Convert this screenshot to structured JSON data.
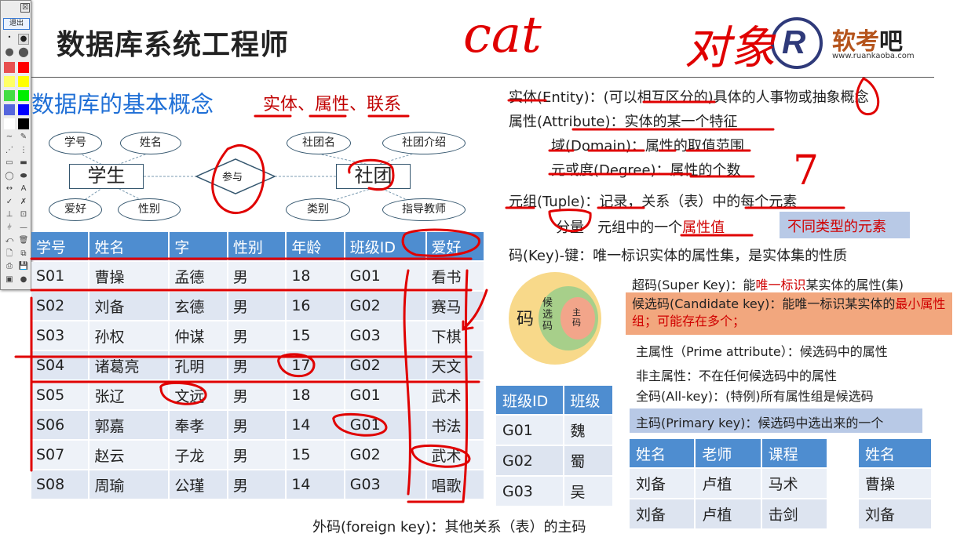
{
  "toolbar": {
    "exit_label": "退出",
    "close": "☒",
    "colors": [
      "#e85050",
      "#ff0000",
      "#ffff66",
      "#ffff00",
      "#44dd44",
      "#00ee00",
      "#5566dd",
      "#0000ff",
      "#ffffff",
      "#000000"
    ],
    "tools": [
      "~",
      "✎",
      "⋰",
      "⋮",
      "▭",
      "▬",
      "◯",
      "⬬",
      "↔",
      "A",
      "✓",
      "✗",
      "⊥",
      "⊡",
      "⫩",
      "—",
      "⤺",
      "🗑",
      "🗋",
      "⧉",
      "⎙",
      "💾",
      "▣",
      "●"
    ]
  },
  "slide": {
    "title": "数据库系统工程师",
    "logo": {
      "brand_a": "软考",
      "brand_b": "吧",
      "url": "www.ruankaoba.com"
    },
    "subtitle": "数据库的基本概念",
    "hint": "实体、属性、联系",
    "er": {
      "entity_left": "学生",
      "entity_right": "社团",
      "relation": "参与",
      "attrs_left": [
        "学号",
        "姓名",
        "爱好",
        "性别"
      ],
      "attrs_right": [
        "社团名",
        "社团介绍",
        "类别",
        "指导教师"
      ]
    },
    "main_table": {
      "headers": [
        "学号",
        "姓名",
        "字",
        "性别",
        "年龄",
        "班级ID",
        "爱好"
      ],
      "rows": [
        [
          "S01",
          "曹操",
          "孟德",
          "男",
          "18",
          "G01",
          "看书"
        ],
        [
          "S02",
          "刘备",
          "玄德",
          "男",
          "16",
          "G02",
          "赛马"
        ],
        [
          "S03",
          "孙权",
          "仲谋",
          "男",
          "15",
          "G03",
          "下棋"
        ],
        [
          "S04",
          "诸葛亮",
          "孔明",
          "男",
          "17",
          "G02",
          "天文"
        ],
        [
          "S05",
          "张辽",
          "文远",
          "男",
          "18",
          "G01",
          "武术"
        ],
        [
          "S06",
          "郭嘉",
          "奉孝",
          "男",
          "14",
          "G01",
          "书法"
        ],
        [
          "S07",
          "赵云",
          "子龙",
          "男",
          "15",
          "G02",
          "武术"
        ],
        [
          "S08",
          "周瑜",
          "公瑾",
          "男",
          "14",
          "G03",
          "唱歌"
        ]
      ]
    },
    "class_table": {
      "headers": [
        "班级ID",
        "班级"
      ],
      "rows": [
        [
          "G01",
          "魏"
        ],
        [
          "G02",
          "蜀"
        ],
        [
          "G03",
          "吴"
        ]
      ]
    },
    "course_table": {
      "headers": [
        "姓名",
        "老师",
        "课程"
      ],
      "rows": [
        [
          "刘备",
          "卢植",
          "马术"
        ],
        [
          "刘备",
          "卢植",
          "击剑"
        ]
      ]
    },
    "name_table": {
      "headers": [
        "姓名"
      ],
      "rows": [
        [
          "曹操"
        ],
        [
          "刘备"
        ]
      ]
    },
    "defs": {
      "entity": "实体(Entity)：(可以相互区分的)具体的人事物或抽象概念",
      "attribute": "属性(Attribute)：实体的某一个特征",
      "domain": "域(Domain)：属性的取值范围",
      "degree": "元或度(Degree)：属性的个数",
      "tuple": "元组(Tuple)：记录，关系（表）中的每个元素",
      "component_a": "分量",
      "component_b": "元组中的一个",
      "component_c": "属性值",
      "component_note": "不同类型的元素",
      "key": "码(Key)-键：唯一标识实体的属性集，是实体集的性质",
      "super_a": "超码(Super Key)：能",
      "super_b": "唯一标识",
      "super_c": "某实体的属性(集)",
      "cand_a": "候选码(Candidate key)：能唯一标识某实体的",
      "cand_b": "最小属性组；可能存在多个；",
      "prime": "主属性（Prime attribute）：候选码中的属性",
      "nonprime": "非主属性：不在任何候选码中的属性",
      "allkey": "全码(All-key)：(特例)所有属性组是候选码",
      "primary": "主码(Primary key)：候选码中选出来的一个",
      "foreign": "外码(foreign key)：其他关系（表）的主码"
    },
    "venn": {
      "outer": "码",
      "middle": "候选码",
      "inner": "主码"
    },
    "annotations": {
      "cat": "cat",
      "object": "对象",
      "seven": "7"
    },
    "colors": {
      "title_blue": "#1f6fd6",
      "header_blue": "#4e8dd0",
      "ink_red": "#e00000",
      "candidate_bg": "#f2a77e",
      "primary_bg": "#b8c9e6"
    }
  }
}
